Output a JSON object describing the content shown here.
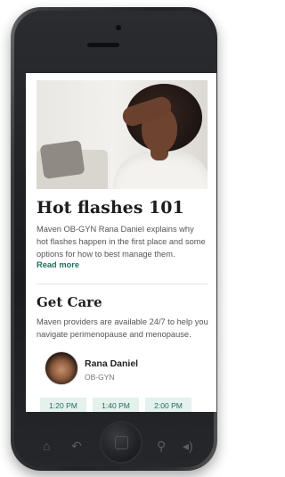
{
  "article": {
    "title": "Hot flashes 101",
    "description": "Maven OB-GYN Rana Daniel explains why hot flashes happen in the first place and some options for how to best manage them.",
    "read_more": "Read more"
  },
  "care": {
    "title": "Get Care",
    "description": "Maven providers are available 24/7 to help you navigate perimenopause and menopause.",
    "provider_name": "Rana Daniel",
    "provider_role": "OB-GYN",
    "time_slots": [
      "1:20 PM",
      "1:40 PM",
      "2:00 PM"
    ]
  },
  "nav_icons": [
    "home-icon",
    "back-icon",
    "home-button",
    "search-icon",
    "volume-icon"
  ],
  "colors": {
    "accent": "#1f6f5c",
    "slot_bg": "#e4f1ec",
    "phone_body": "#202226"
  }
}
